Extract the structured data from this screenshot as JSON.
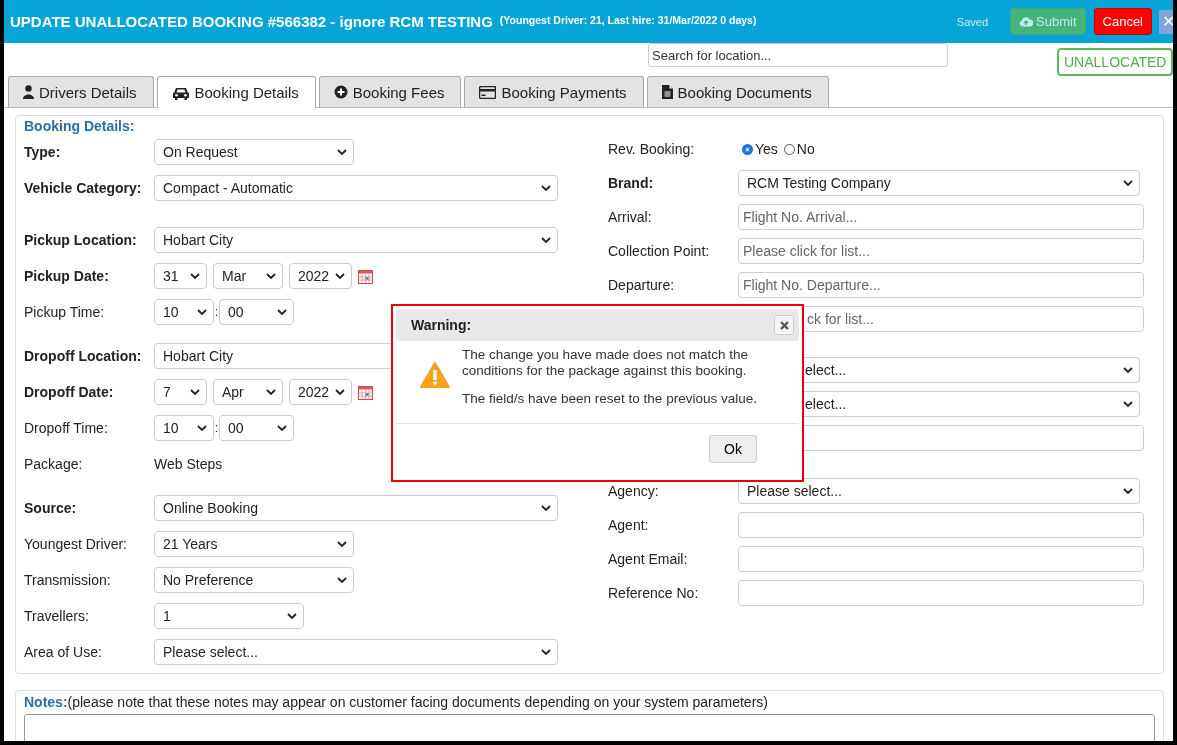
{
  "header": {
    "title": "UPDATE UNALLOCATED BOOKING #566382 - ignore RCM TESTING",
    "subtitle": "(Youngest Driver: 21, Last hire: 31/Mar/2022 0 days)",
    "saved": "Saved",
    "submit": {
      "label": "Submit",
      "disabled": true
    },
    "cancel": "Cancel",
    "close": "✕"
  },
  "search": {
    "placeholder": "Search for location..."
  },
  "status_badge": "UNALLOCATED",
  "tabs": [
    {
      "label": "Drivers Details",
      "kind": "user",
      "selected": false
    },
    {
      "label": "Booking Details",
      "kind": "car",
      "selected": true
    },
    {
      "label": "Booking Fees",
      "kind": "plus",
      "selected": false
    },
    {
      "label": "Booking Payments",
      "kind": "card",
      "selected": false
    },
    {
      "label": "Booking Documents",
      "kind": "file",
      "selected": false
    }
  ],
  "form": {
    "heading": "Booking Details:",
    "left_groups": [
      [
        {
          "label": "Type:",
          "bold": true,
          "kind": "smallselect",
          "value": "On Request"
        },
        {
          "label": "Vehicle Category:",
          "bold": true,
          "kind": "select",
          "value": "Compact - Automatic"
        }
      ],
      [
        {
          "label": "Pickup Location:",
          "bold": true,
          "kind": "select",
          "value": "Hobart City"
        },
        {
          "label": "Pickup Date:",
          "bold": true,
          "kind": "date",
          "day": "31",
          "month": "Mar",
          "year": "2022"
        },
        {
          "label": "Pickup Time:",
          "bold": false,
          "kind": "time",
          "hour": "10",
          "separator": ":",
          "minute": "00"
        }
      ],
      [
        {
          "label": "Dropoff Location:",
          "bold": true,
          "kind": "cutselect",
          "value": "Hobart City"
        },
        {
          "label": "Dropoff Date:",
          "bold": true,
          "kind": "date",
          "day": "7",
          "month": "Apr",
          "year": "2022"
        },
        {
          "label": "Dropoff Time:",
          "bold": false,
          "kind": "time",
          "hour": "10",
          "separator": ":",
          "minute": "00"
        },
        {
          "label": "Package:",
          "bold": false,
          "kind": "text",
          "value": "Web Steps"
        }
      ],
      [
        {
          "label": "Source:",
          "bold": true,
          "kind": "select",
          "value": "Online Booking"
        },
        {
          "label": "Youngest Driver:",
          "bold": false,
          "kind": "smallselect",
          "value": "21 Years"
        },
        {
          "label": "Transmission:",
          "bold": false,
          "kind": "smallselect",
          "value": "No Preference"
        },
        {
          "label": "Travellers:",
          "bold": false,
          "kind": "tinyselect",
          "value": "1"
        },
        {
          "label": "Area of Use:",
          "bold": false,
          "kind": "select",
          "value": "Please select..."
        }
      ]
    ],
    "right_groups": [
      [
        {
          "label": "Rev. Booking:",
          "bold": false,
          "kind": "radio",
          "options": [
            {
              "label": "Yes",
              "selected": true
            },
            {
              "label": "No",
              "selected": false
            }
          ]
        },
        {
          "label": "Brand:",
          "bold": true,
          "kind": "select",
          "value": "RCM Testing Company"
        },
        {
          "label": "Arrival:",
          "bold": false,
          "kind": "input",
          "placeholder": "Flight No. Arrival..."
        },
        {
          "label": "Collection Point:",
          "bold": false,
          "kind": "input",
          "placeholder": "Please click for list..."
        },
        {
          "label": "Departure:",
          "bold": false,
          "kind": "input",
          "placeholder": "Flight No. Departure..."
        },
        {
          "kind": "input",
          "placeholder": "ck for list...",
          "covered": true
        }
      ],
      [
        {
          "kind": "select",
          "value": "elect...",
          "covered": true
        },
        {
          "kind": "select",
          "value": "elect...",
          "covered": true
        },
        {
          "kind": "input"
        }
      ],
      [
        {
          "label": "Agency:",
          "bold": false,
          "kind": "select",
          "value": "Please select..."
        },
        {
          "label": "Agent:",
          "bold": false,
          "kind": "input"
        },
        {
          "label": "Agent Email:",
          "bold": false,
          "kind": "input"
        },
        {
          "label": "Reference No:",
          "bold": false,
          "kind": "input"
        }
      ]
    ]
  },
  "notes": {
    "label": "Notes:",
    "hint": "(please note that these notes may appear on customer facing documents depending on your system parameters)"
  },
  "dialog": {
    "title": "Warning:",
    "paragraphs": [
      "The change you have made does not match the conditions for the package against this booking.",
      "The field/s have been reset to the previous value."
    ],
    "button": "Ok"
  }
}
